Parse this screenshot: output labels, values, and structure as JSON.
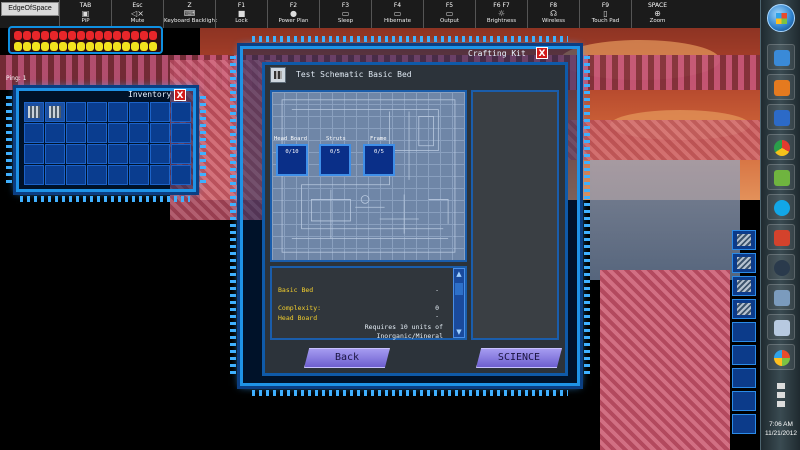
{
  "window": {
    "title": "EdgeOfSpace"
  },
  "keystrip": [
    {
      "key": "TAB",
      "label": "PiP",
      "icon": "pip-icon"
    },
    {
      "key": "Esc",
      "label": "Mute",
      "icon": "mute-icon"
    },
    {
      "key": "Z",
      "label": "Keyboard Backlight",
      "icon": "keyboard-icon"
    },
    {
      "key": "F1",
      "label": "Lock",
      "icon": "lock-icon"
    },
    {
      "key": "F2",
      "label": "Power Plan",
      "icon": "power-plan-icon"
    },
    {
      "key": "F3",
      "label": "Sleep",
      "icon": "sleep-icon"
    },
    {
      "key": "F4",
      "label": "Hibernate",
      "icon": "hibernate-icon"
    },
    {
      "key": "F5",
      "label": "Output",
      "icon": "output-icon"
    },
    {
      "key": "F6  F7",
      "label": "Brightness",
      "icon": "brightness-icon"
    },
    {
      "key": "F8",
      "label": "Wireless",
      "icon": "wireless-icon"
    },
    {
      "key": "F9",
      "label": "Touch Pad",
      "icon": "touchpad-icon"
    },
    {
      "key": "SPACE",
      "label": "Zoom",
      "icon": "zoom-icon"
    }
  ],
  "hud": {
    "ping": "Ping: 1",
    "health_fraction": 1.0,
    "colors": {
      "top": "#e8262a",
      "bottom": "#f2e31e"
    }
  },
  "inventory": {
    "title": "Inventory",
    "close": "X",
    "item_slots": [
      0,
      1
    ]
  },
  "crafting": {
    "title": "Crafting Kit",
    "close": "X",
    "schematic": "Test Schematic Basic Bed",
    "components": [
      {
        "name": "Head Board",
        "count": "0/10"
      },
      {
        "name": "Struts",
        "count": "0/5"
      },
      {
        "name": "Frame",
        "count": "0/5"
      }
    ],
    "info": {
      "item": "Basic Bed",
      "item_value": "-",
      "complexity_label": "Complexity:",
      "complexity_value": "0",
      "part": "Head Board",
      "part_value": "-",
      "requirement": "Requires 10 units of",
      "material": "Inorganic/Mineral"
    },
    "back_label": "Back",
    "science_label": "SCIENCE"
  },
  "clock": {
    "time": "7:06 AM",
    "date": "11/21/2012"
  },
  "colors": {
    "accent": "#1f93e6",
    "button": "#8f84e6",
    "highlight": "#f3cf2d",
    "close": "#d11b1b"
  }
}
